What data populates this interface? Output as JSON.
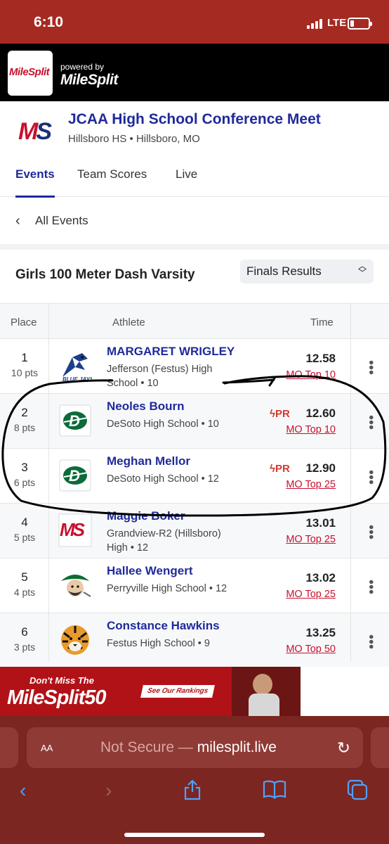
{
  "status_bar": {
    "time": "6:10",
    "network": "LTE"
  },
  "milesplit_header": {
    "logo_text": "MileSplit",
    "powered_by": "powered by",
    "brand": "MileSplit"
  },
  "meet": {
    "logo": "MS",
    "title": "JCAA High School Conference Meet",
    "location": "Hillsboro HS • Hillsboro, MO",
    "tabs": [
      "Events",
      "Team Scores",
      "Live"
    ],
    "active_tab": "Events"
  },
  "nav": {
    "back_label": "All Events"
  },
  "event": {
    "title": "Girls 100 Meter Dash Varsity",
    "results_select": "Finals Results"
  },
  "table": {
    "columns": {
      "place": "Place",
      "athlete": "Athlete",
      "time": "Time"
    },
    "rows": [
      {
        "place": "1",
        "pts": "10 pts",
        "name": "MARGARET WRIGLEY",
        "school": "Jefferson (Festus) High School • 10",
        "pr": "",
        "time": "12.58",
        "rank": "MO Top 10",
        "logo": "blue-jays-logo",
        "logo_text": "BLUE JAYS"
      },
      {
        "place": "2",
        "pts": "8 pts",
        "name": "Neoles Bourn",
        "school": "DeSoto High School • 10",
        "pr": "PR",
        "time": "12.60",
        "rank": "MO Top 10",
        "logo": "desoto-logo",
        "logo_text": "D"
      },
      {
        "place": "3",
        "pts": "6 pts",
        "name": "Meghan Mellor",
        "school": "DeSoto High School • 12",
        "pr": "PR",
        "time": "12.90",
        "rank": "MO Top 25",
        "logo": "desoto-logo",
        "logo_text": "D"
      },
      {
        "place": "4",
        "pts": "5 pts",
        "name": "Maggie Boker",
        "school": "Grandview-R2 (Hillsboro) High • 12",
        "pr": "",
        "time": "13.01",
        "rank": "MO Top 25",
        "logo": "milesplit-ms-logo",
        "logo_text": "MS"
      },
      {
        "place": "5",
        "pts": "4 pts",
        "name": "Hallee Wengert",
        "school": "Perryville High School • 12",
        "pr": "",
        "time": "13.02",
        "rank": "MO Top 25",
        "logo": "pirate-logo",
        "logo_text": ""
      },
      {
        "place": "6",
        "pts": "3 pts",
        "name": "Constance Hawkins",
        "school": "Festus High School • 9",
        "pr": "",
        "time": "13.25",
        "rank": "MO Top 50",
        "logo": "tiger-logo",
        "logo_text": ""
      }
    ]
  },
  "ad": {
    "line1": "Don't Miss The",
    "brand": "MileSplit50",
    "cta": "See Our Rankings"
  },
  "browser": {
    "aa": "AA",
    "not_secure": "Not Secure",
    "separator": "—",
    "domain": "milesplit.live"
  },
  "colors": {
    "status_red": "#a52a22",
    "brand_red": "#c8102e",
    "link_blue": "#1f2a9a",
    "safari_blue": "#4ea1ff",
    "browser_bar": "#7b2621"
  }
}
